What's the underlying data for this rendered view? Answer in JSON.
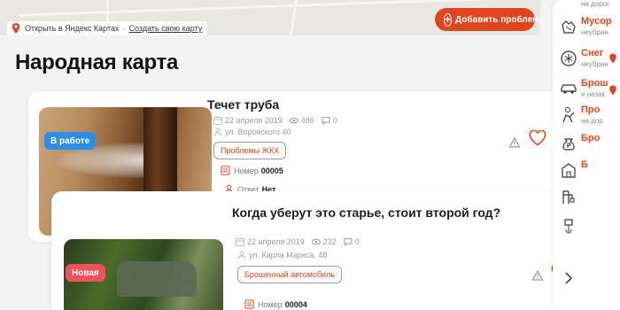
{
  "map": {
    "open_in_yandex": "Открыть в Яндекс Картах",
    "create_map": "Создать свою карту"
  },
  "header": {
    "title": "Народная карта",
    "add_problem_label": "Добавить проблему"
  },
  "problems": [
    {
      "status": "В работе",
      "status_color": "#2e8de6",
      "title": "Течет труба",
      "date": "22 апреля 2019",
      "views": "486",
      "comments": "0",
      "address": "ул. Воровского 40",
      "category": "Проблемы ЖКХ",
      "number_label": "Номер",
      "number": "00005",
      "answer_label": "Ответ",
      "answer": "Нет"
    },
    {
      "status": "Новая",
      "status_color": "#f0525a",
      "title": "Когда уберут это старье, стоит второй год?",
      "date": "22 апреля 2019",
      "views": "232",
      "comments": "0",
      "address": "ул. Карла Маркса, 48",
      "category": "Брошенный автомобиль",
      "number_label": "Номер",
      "number": "00004"
    }
  ],
  "sidebar": {
    "top_partial": "на дорог",
    "categories": [
      {
        "title": "Мусор",
        "subtitle": "неубран",
        "icon": "trash-icon"
      },
      {
        "title": "Снег",
        "subtitle": "неубран",
        "icon": "snowflake-icon"
      },
      {
        "title": "Брош",
        "subtitle": "и незак",
        "icon": "car-icon"
      },
      {
        "title": "Про",
        "subtitle": "на дор",
        "icon": "road-worker-icon"
      },
      {
        "title": "Бро",
        "subtitle": "",
        "icon": "ruble-bag-icon"
      },
      {
        "title": "Б",
        "subtitle": "",
        "icon": "building-icon"
      },
      {
        "title": "",
        "subtitle": "",
        "icon": "tools-icon"
      }
    ]
  },
  "colors": {
    "accent": "#e0461d",
    "background": "#f3f3f4"
  }
}
